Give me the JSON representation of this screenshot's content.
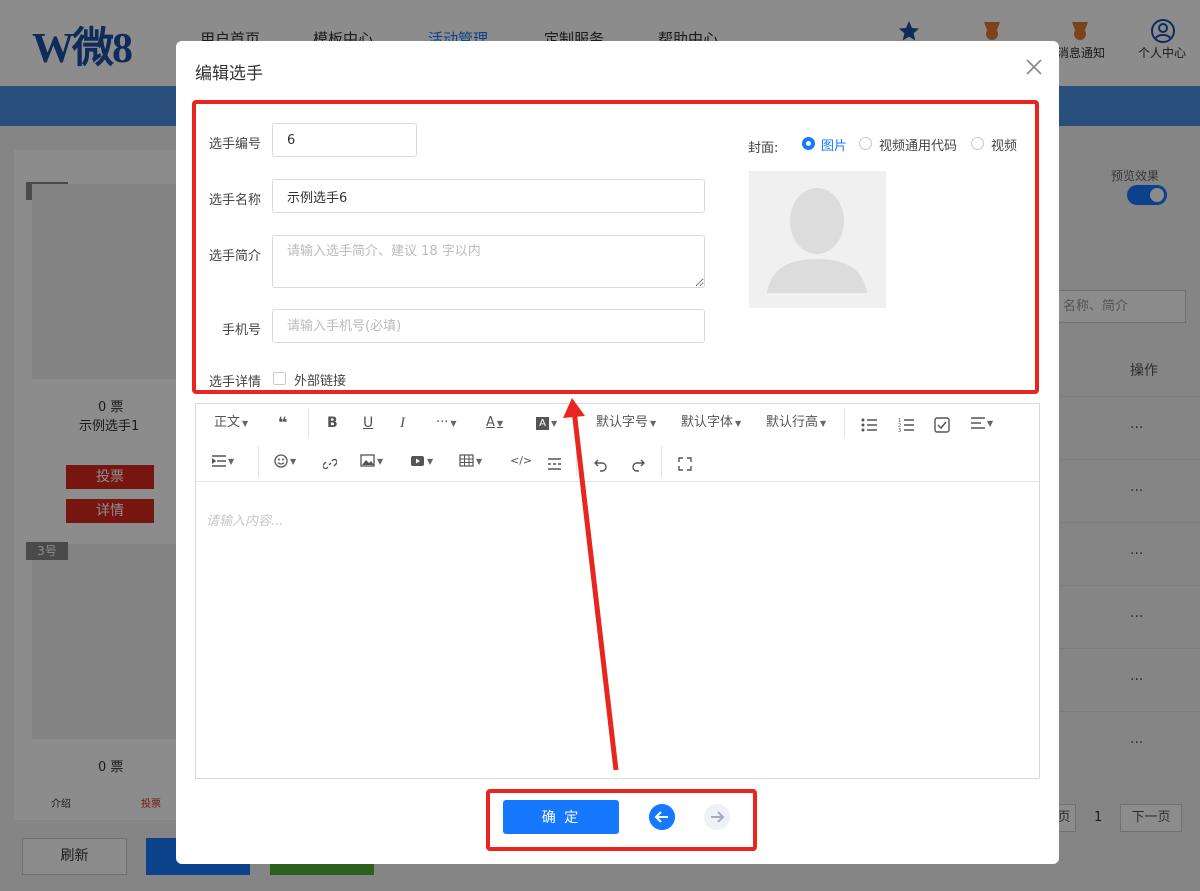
{
  "header": {
    "logo": "W微8",
    "nav": [
      "用户首页",
      "模板中心",
      "活动管理",
      "定制服务",
      "帮助中心"
    ],
    "right_labels": [
      "消息通知",
      "个人中心"
    ]
  },
  "background": {
    "cards": [
      {
        "tag": "1号",
        "votes": "0 票",
        "name": "示例选手1",
        "vote_btn": "投票",
        "detail_btn": "详情"
      },
      {
        "tag": "3号",
        "votes": "0 票"
      }
    ],
    "bottom_tabs": [
      "介绍",
      "投票"
    ],
    "refresh_btn": "刷新",
    "preview_label": "预览效果",
    "search_placeholder": "名称、简介",
    "ops_header": "操作",
    "ops_cell": "···",
    "pager": {
      "prev": "页",
      "page": "1",
      "next": "下一页"
    }
  },
  "modal": {
    "title": "编辑选手",
    "fields": {
      "number": {
        "label": "选手编号",
        "value": "6"
      },
      "name": {
        "label": "选手名称",
        "value": "示例选手6"
      },
      "intro": {
        "label": "选手简介",
        "placeholder": "请输入选手简介、建议 18 字以内"
      },
      "phone": {
        "label": "手机号",
        "placeholder": "请输入手机号(必填)"
      },
      "detail": {
        "label": "选手详情",
        "external_link": "外部链接"
      }
    },
    "cover": {
      "label": "封面:",
      "options": [
        "图片",
        "视频通用代码",
        "视频"
      ],
      "selected": "图片"
    },
    "toolbar": {
      "paragraph": "正文",
      "font_size": "默认字号",
      "font_family": "默认字体",
      "line_height": "默认行高"
    },
    "editor_placeholder": "请输入内容...",
    "confirm": "确 定"
  },
  "colors": {
    "accent": "#1677ff",
    "annotation_red": "#e8251e",
    "danger_button": "#d9281e"
  }
}
